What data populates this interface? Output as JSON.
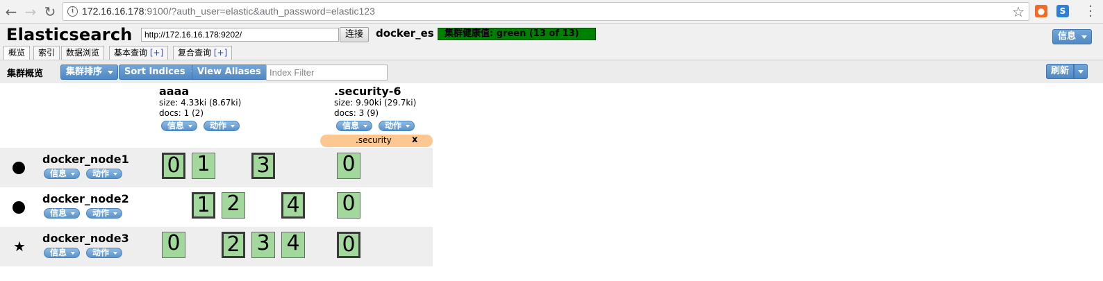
{
  "browser": {
    "url_host": "172.16.16.178",
    "url_rest": ":9100/?auth_user=elastic&auth_password=elastic123"
  },
  "header": {
    "title": "Elasticsearch",
    "connect_url": "http://172.16.16.178:9202/",
    "connect_label": "连接",
    "cluster_name": "docker_es",
    "health": "集群健康值: green (13 of 13)",
    "info_label": "信息"
  },
  "tabs": [
    {
      "label": "概览"
    },
    {
      "label": "索引"
    },
    {
      "label": "数据浏览"
    },
    {
      "label": "基本查询",
      "plus": "[+]"
    },
    {
      "label": "复合查询",
      "plus": "[+]"
    }
  ],
  "toolbar": {
    "title": "集群概览",
    "sort_cluster": "集群排序",
    "sort_indices": "Sort Indices",
    "view_aliases": "View Aliases",
    "filter_placeholder": "Index Filter",
    "refresh": "刷新"
  },
  "labels": {
    "info": "信息",
    "action": "动作"
  },
  "indices": [
    {
      "name": "aaaa",
      "size": "size: 4.33ki (8.67ki)",
      "docs": "docs: 1 (2)"
    },
    {
      "name": ".security-6",
      "size": "size: 9.90ki (29.7ki)",
      "docs": "docs: 3 (9)"
    }
  ],
  "alias": {
    "name": ".security",
    "remove": "x"
  },
  "nodes": [
    {
      "name": "docker_node1",
      "marker": "dot",
      "shards": [
        {
          "index": 0,
          "slot": 0,
          "label": "0",
          "primary": true
        },
        {
          "index": 0,
          "slot": 1,
          "label": "1",
          "primary": false
        },
        {
          "index": 0,
          "slot": 3,
          "label": "3",
          "primary": true
        },
        {
          "index": 1,
          "slot": 0,
          "label": "0",
          "primary": false
        }
      ]
    },
    {
      "name": "docker_node2",
      "marker": "dot",
      "shards": [
        {
          "index": 0,
          "slot": 1,
          "label": "1",
          "primary": true
        },
        {
          "index": 0,
          "slot": 2,
          "label": "2",
          "primary": false
        },
        {
          "index": 0,
          "slot": 4,
          "label": "4",
          "primary": true
        },
        {
          "index": 1,
          "slot": 0,
          "label": "0",
          "primary": false
        }
      ]
    },
    {
      "name": "docker_node3",
      "marker": "star",
      "marker_glyph": "★",
      "shards": [
        {
          "index": 0,
          "slot": 0,
          "label": "0",
          "primary": false
        },
        {
          "index": 0,
          "slot": 2,
          "label": "2",
          "primary": true
        },
        {
          "index": 0,
          "slot": 3,
          "label": "3",
          "primary": false
        },
        {
          "index": 0,
          "slot": 4,
          "label": "4",
          "primary": false
        },
        {
          "index": 1,
          "slot": 0,
          "label": "0",
          "primary": true
        }
      ]
    }
  ],
  "colors": {
    "health_green": "#008000",
    "shard_fill": "#a2d89c",
    "alias_fill": "#fcc791",
    "button_blue": "#5a93ca"
  }
}
